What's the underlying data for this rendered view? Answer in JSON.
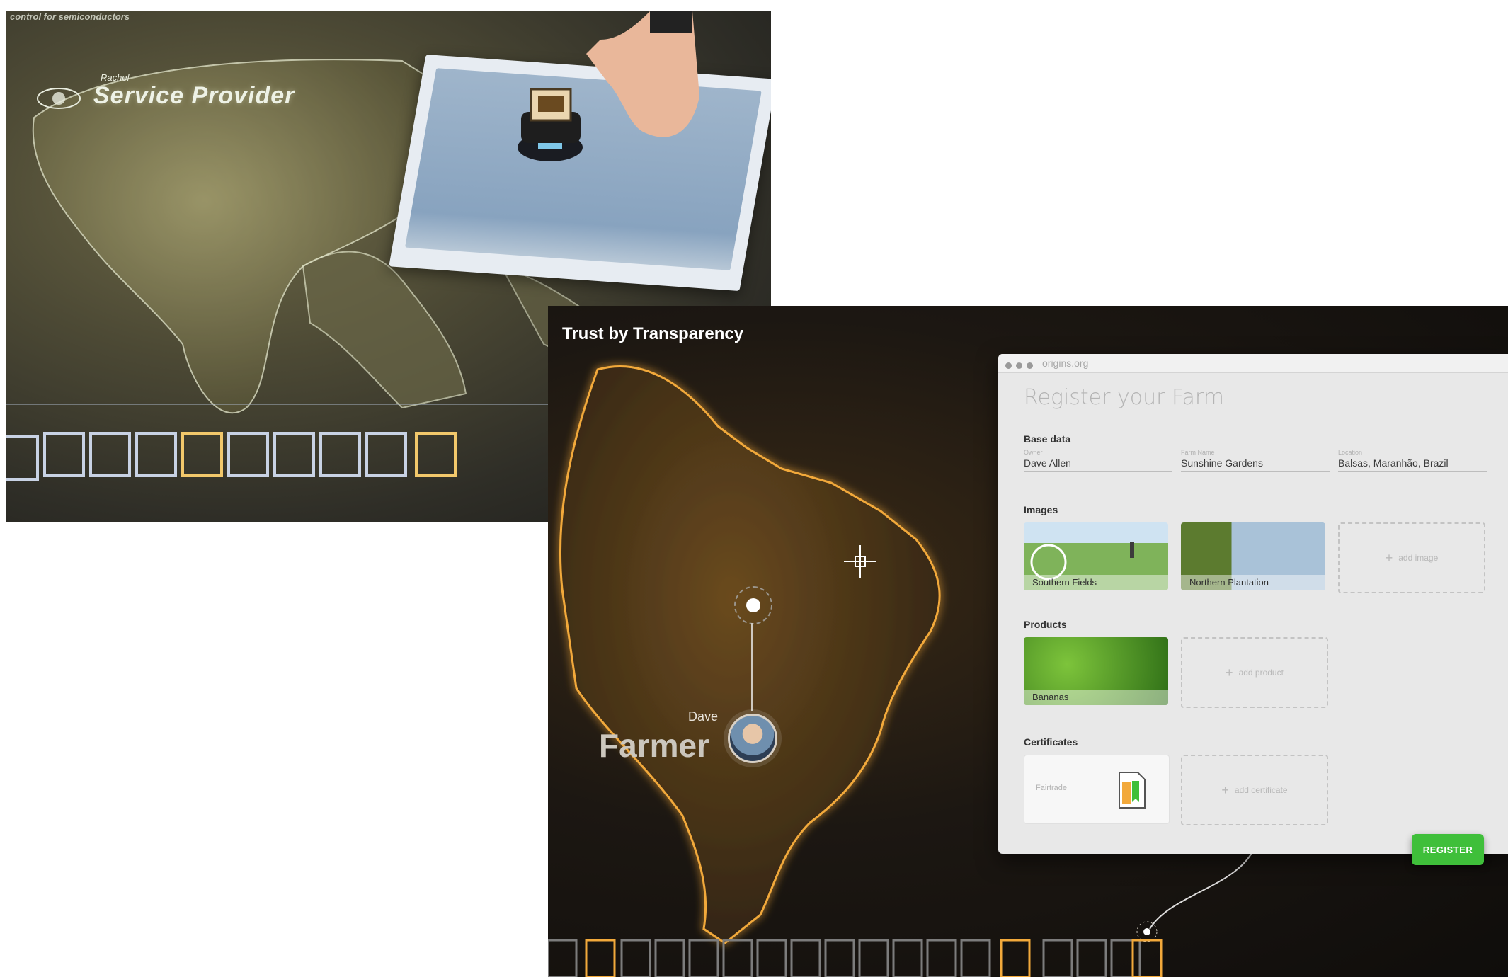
{
  "photo": {
    "caption": "control for semiconductors",
    "provider_name": "Rachel",
    "provider_role": "Service Provider"
  },
  "ui": {
    "brand": "Trust by Transparency",
    "person": {
      "name": "Dave",
      "role": "Farmer"
    },
    "window": {
      "url": "origins.org",
      "heading": "Register your Farm",
      "base_data": {
        "title": "Base data",
        "fields": [
          {
            "label": "Owner",
            "value": "Dave Allen"
          },
          {
            "label": "Farm Name",
            "value": "Sunshine Gardens"
          },
          {
            "label": "Location",
            "value": "Balsas, Maranhão, Brazil"
          }
        ]
      },
      "images": {
        "title": "Images",
        "items": [
          {
            "caption": "Southern Fields"
          },
          {
            "caption": "Northern Plantation"
          }
        ],
        "add_label": "add image"
      },
      "products": {
        "title": "Products",
        "items": [
          {
            "caption": "Bananas"
          }
        ],
        "add_label": "add product"
      },
      "certificates": {
        "title": "Certificates",
        "item_label": "Fairtrade",
        "add_label": "add certificate"
      },
      "register_label": "REGISTER"
    },
    "colors": {
      "accent_gold": "#f2a93b",
      "register_green": "#3fbf3a",
      "background": "#14110e"
    }
  }
}
